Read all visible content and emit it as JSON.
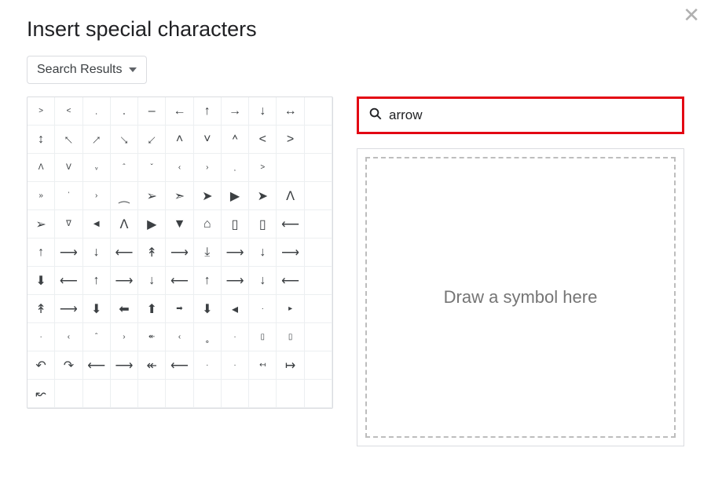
{
  "dialog": {
    "title": "Insert special characters",
    "dropdown_label": "Search Results"
  },
  "search": {
    "value": "arrow",
    "placeholder": ""
  },
  "draw_panel": {
    "hint": "Draw a symbol here"
  },
  "char_grid": {
    "cols": 11,
    "rows": 11,
    "chars": [
      "˃",
      "˂",
      "˲",
      "˳",
      "–",
      "←",
      "↑",
      "→",
      "↓",
      "↔",
      null,
      "↕",
      "↖",
      "↗",
      "↘",
      "↙",
      "˄",
      "˅",
      "⌃",
      "<",
      ">",
      null,
      "ᐱ",
      "ᐯ",
      "ᵥ",
      "ˆ",
      "ˇ",
      "‹",
      "›",
      "˲",
      "˃",
      null,
      null,
      "»",
      "᾽",
      "›",
      "⁔",
      "➢",
      "➣",
      "➤",
      "▶",
      "➤",
      "ᐱ",
      null,
      "➢",
      "ᐁ",
      "◀",
      "ᐱ",
      "▶",
      "▼",
      "⌂",
      "▯",
      "▯",
      "⟵",
      null,
      "↑",
      "⟶",
      "↓",
      "⟵",
      "↟",
      "⟶",
      "⤓",
      "⟶",
      "↓",
      "⟶",
      null,
      "⬇",
      "⟵",
      "↑",
      "⟶",
      "↓",
      "⟵",
      "↑",
      "⟶",
      "↓",
      "⟵",
      null,
      "↟",
      "⟶",
      "⬇",
      "⬅",
      "⬆",
      "➡",
      "⬇",
      "◂",
      "·",
      "▸",
      null,
      "·",
      "‹",
      "ˆ",
      "›",
      "↞",
      "‹",
      "˳",
      "·",
      "▯",
      "▯",
      null,
      "↶",
      "↷",
      "⟵",
      "⟶",
      "↞",
      "⟵",
      "·",
      "·",
      "↤",
      "↦",
      null,
      "↜",
      null,
      null,
      null,
      null,
      null,
      null,
      null,
      null,
      null,
      null
    ],
    "small_font_indices": [
      0,
      1,
      2,
      3,
      22,
      23,
      24,
      25,
      26,
      27,
      28,
      29,
      30,
      33,
      34,
      35,
      45,
      46,
      82,
      85,
      86,
      87,
      88,
      89,
      90,
      91,
      92,
      93,
      95,
      96,
      97,
      98,
      105,
      106,
      107
    ]
  }
}
